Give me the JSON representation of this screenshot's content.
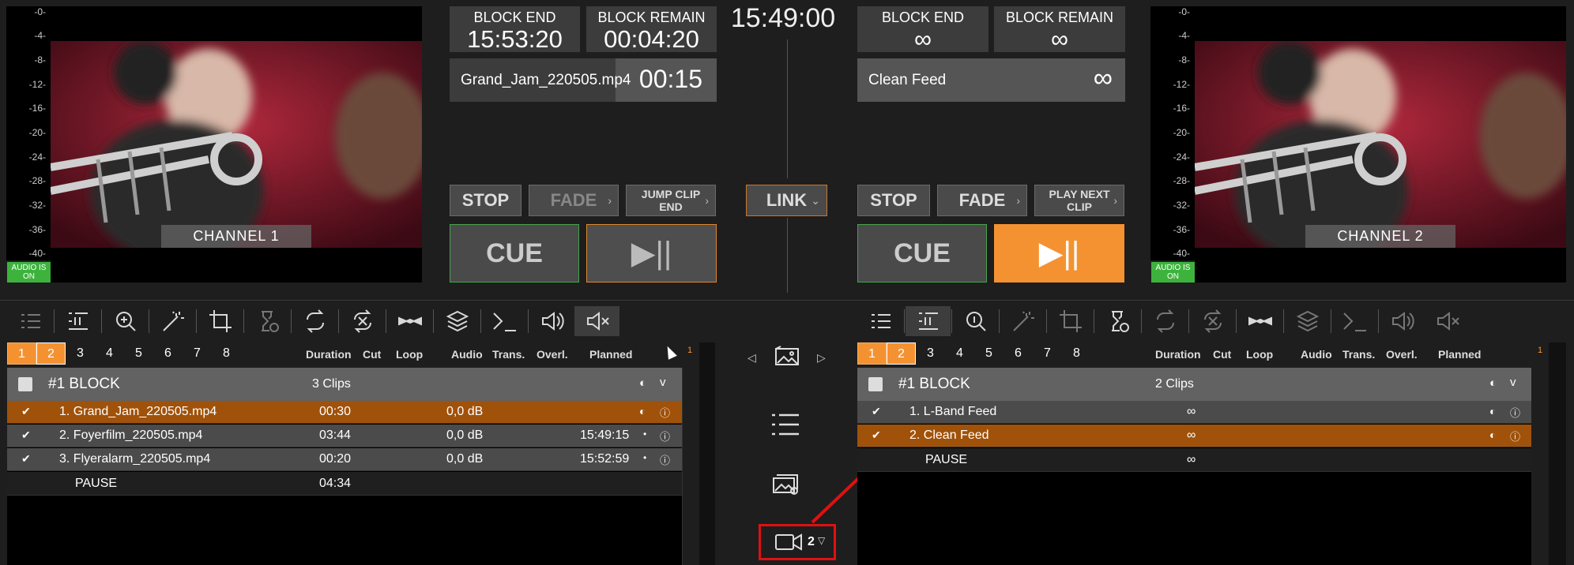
{
  "meter_scale": [
    "-0-",
    "-4-",
    "-8-",
    "-12-",
    "-16-",
    "-20-",
    "-24-",
    "-28-",
    "-32-",
    "-36-",
    "-40-"
  ],
  "clock": "15:49:00",
  "channel1": {
    "label": "CHANNEL 1",
    "audio_badge": "AUDIO IS ON",
    "block_end_label": "BLOCK END",
    "block_end_value": "15:53:20",
    "block_remain_label": "BLOCK REMAIN",
    "block_remain_value": "00:04:20",
    "clip_name": "Grand_Jam_220505.mp4",
    "clip_remain": "00:15",
    "progress": 0.62,
    "buttons": {
      "stop": "STOP",
      "fade": "FADE",
      "jump1": "JUMP CLIP",
      "jump2": "END",
      "cue": "CUE",
      "play": "▶||"
    }
  },
  "channel2": {
    "label": "CHANNEL 2",
    "audio_badge": "AUDIO IS ON",
    "block_end_label": "BLOCK END",
    "block_end_value": "∞",
    "block_remain_label": "BLOCK REMAIN",
    "block_remain_value": "∞",
    "clip_name": "Clean Feed",
    "clip_remain": "∞",
    "buttons": {
      "stop": "STOP",
      "fade": "FADE",
      "next1": "PLAY NEXT",
      "next2": "CLIP",
      "cue": "CUE",
      "play": "▶||"
    }
  },
  "link_button": "LINK",
  "columns": {
    "duration": "Duration",
    "cut": "Cut",
    "loop": "Loop",
    "audio": "Audio",
    "trans": "Trans.",
    "overl": "Overl.",
    "planned": "Planned"
  },
  "tabs": [
    "1",
    "2",
    "3",
    "4",
    "5",
    "6",
    "7",
    "8"
  ],
  "playlist1": {
    "block_label": "#1  BLOCK",
    "clips_count": "3 Clips",
    "rows": [
      {
        "name": "1. Grand_Jam_220505.mp4",
        "duration": "00:30",
        "audio": "0,0 dB",
        "planned": ""
      },
      {
        "name": "2. Foyerfilm_220505.mp4",
        "duration": "03:44",
        "audio": "0,0 dB",
        "planned": "15:49:15"
      },
      {
        "name": "3. Flyeralarm_220505.mp4",
        "duration": "00:20",
        "audio": "0,0 dB",
        "planned": "15:52:59"
      }
    ],
    "pause": {
      "name": "PAUSE",
      "duration": "04:34"
    }
  },
  "playlist2": {
    "block_label": "#1  BLOCK",
    "clips_count": "2 Clips",
    "rows": [
      {
        "name": "1. L-Band Feed",
        "duration": "∞"
      },
      {
        "name": "2. Clean Feed",
        "duration": "∞"
      }
    ],
    "pause": {
      "name": "PAUSE",
      "duration": "∞"
    }
  },
  "row_marker": "1",
  "cam_selector": "2",
  "colors": {
    "accent": "#f49232",
    "green": "#3db33d",
    "row_orange": "#a0520a",
    "highlight_red": "#e01010"
  }
}
